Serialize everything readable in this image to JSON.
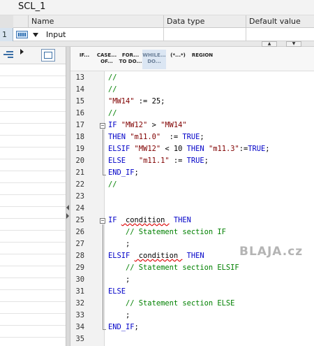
{
  "window": {
    "title": "SCL_1"
  },
  "interface": {
    "columns": {
      "name": "Name",
      "data_type": "Data type",
      "default_value": "Default value"
    },
    "row": {
      "number": "1",
      "name": "Input"
    }
  },
  "toolbar": {
    "buttons": [
      {
        "l1": "IF...",
        "l2": ""
      },
      {
        "l1": "CASE...",
        "l2": "OF..."
      },
      {
        "l1": "FOR...",
        "l2": "TO DO..."
      },
      {
        "l1": "WHILE...",
        "l2": "DO..."
      },
      {
        "l1": "(*...*)",
        "l2": ""
      },
      {
        "l1": "REGION",
        "l2": ""
      }
    ]
  },
  "editor": {
    "line_numbers": [
      "13",
      "14",
      "15",
      "16",
      "17",
      "18",
      "19",
      "20",
      "21",
      "22",
      "23",
      "24",
      "25",
      "26",
      "27",
      "28",
      "29",
      "30",
      "31",
      "32",
      "33",
      "34",
      "35"
    ]
  },
  "watermark": "BLAJA.cz",
  "colors": {
    "keyword": "#0000c8",
    "string": "#800000",
    "comment": "#008000",
    "selected_button": "#dbe6f3"
  }
}
